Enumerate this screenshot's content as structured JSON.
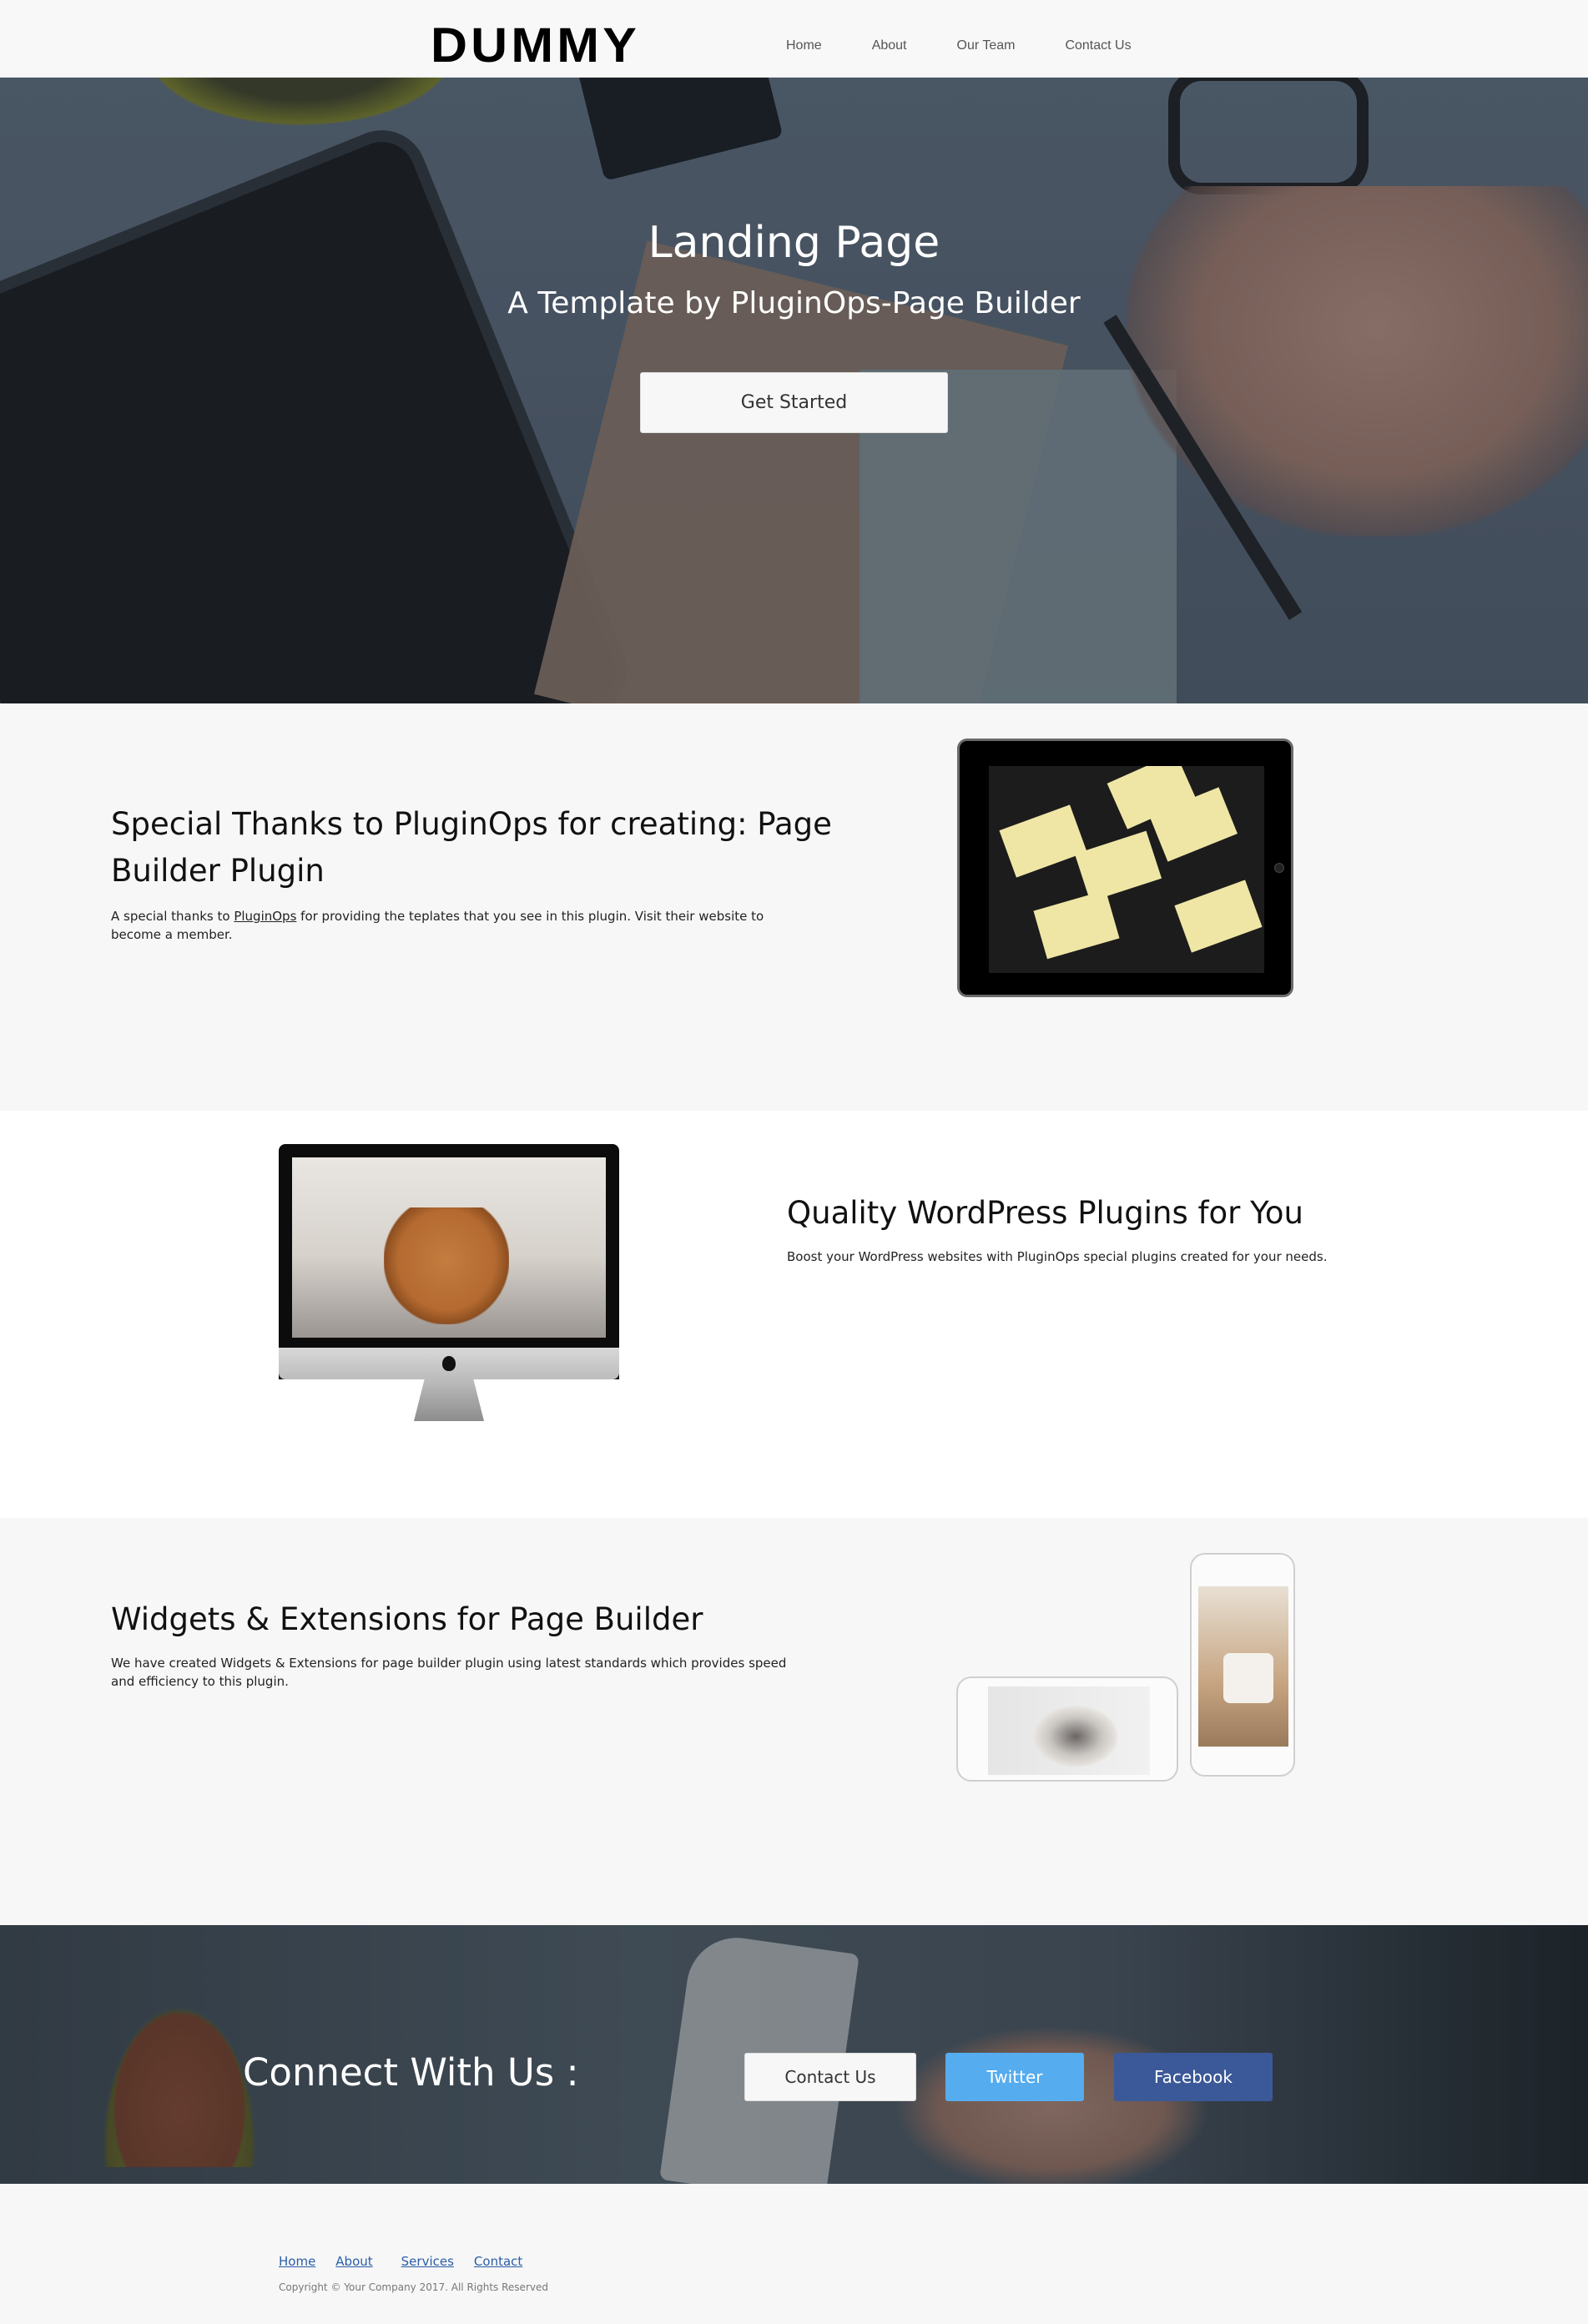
{
  "nav": {
    "logo": "DUMMY",
    "links": [
      "Home",
      "About",
      "Our Team",
      "Contact Us"
    ]
  },
  "hero": {
    "title": "Landing Page",
    "subtitle": "A Template by PluginOps-Page Builder",
    "cta_label": "Get Started"
  },
  "section1": {
    "heading_line1": "Special Thanks to PluginOps for creating: Page",
    "heading_line2": "Builder Plugin",
    "text_before": "A special thanks to ",
    "link_text": "PluginOps",
    "text_after": " for providing the teplates that you see in this plugin. Visit their website to",
    "text_line2": "become a member."
  },
  "section2": {
    "heading": "Quality WordPress Plugins for You",
    "text": "Boost your WordPress websites with PluginOps special plugins created for your needs."
  },
  "section3": {
    "heading": "Widgets & Extensions for Page Builder",
    "text_line1": "We have created Widgets & Extensions for page builder plugin using latest standards which provides speed",
    "text_line2": "and efficiency to this plugin."
  },
  "connect": {
    "title": "Connect With Us :",
    "contact_label": "Contact Us",
    "twitter_label": "Twitter",
    "facebook_label": "Facebook",
    "colors": {
      "twitter": "#55acee",
      "facebook": "#3b5998"
    }
  },
  "footer": {
    "links": [
      "Home",
      "About",
      "Services",
      "Contact"
    ],
    "copyright": "Copyright © Your Company 2017. All Rights Reserved"
  }
}
